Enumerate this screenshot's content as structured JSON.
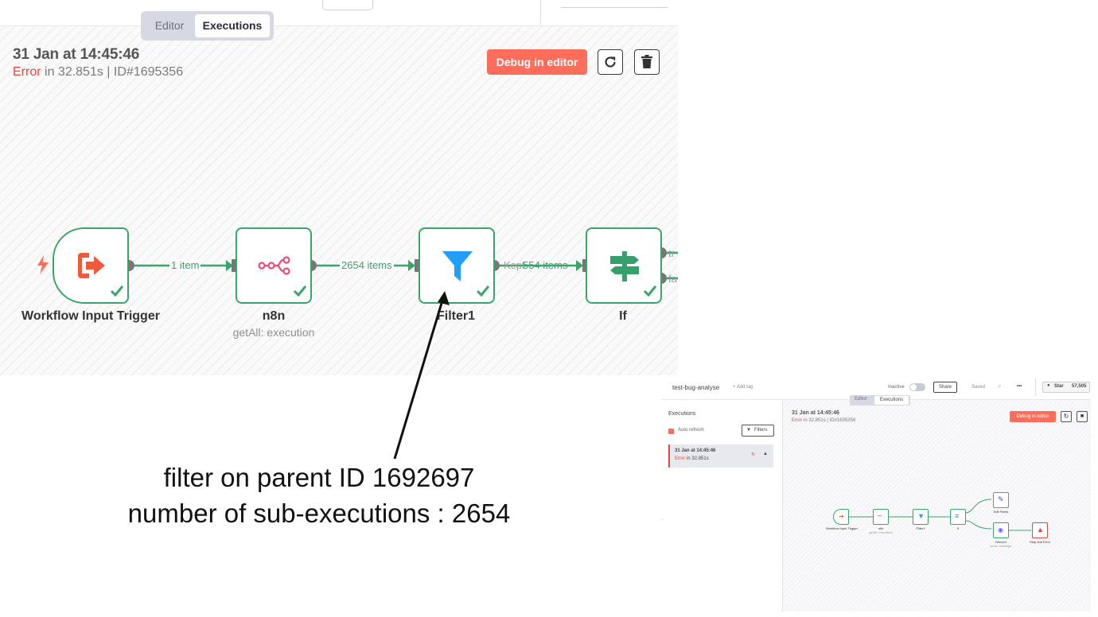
{
  "tabs": {
    "editor": "Editor",
    "executions": "Executions"
  },
  "execution": {
    "time": "31 Jan at 14:45:46",
    "status": "Error",
    "details": "in 32.851s | ID#1695356",
    "debug_label": "Debug in editor"
  },
  "nodes": [
    {
      "name": "Workflow Input Trigger",
      "sub": "",
      "icon": "sign-out-icon",
      "color": "#ef5a3c"
    },
    {
      "name": "n8n",
      "sub": "getAll: execution",
      "icon": "n8n-logo-icon",
      "color": "#ea4b71"
    },
    {
      "name": "Filter1",
      "sub": "",
      "icon": "funnel-icon",
      "color": "#229eff"
    },
    {
      "name": "If",
      "sub": "",
      "icon": "signpost-icon",
      "color": "#35a06c"
    }
  ],
  "connections": [
    "1 item",
    "2654 items",
    "Kept",
    "554 items"
  ],
  "if_outputs": [
    "tr",
    "fa"
  ],
  "annotation": {
    "line1": "filter on parent ID 1692697",
    "line2": "number of sub-executions : 2654"
  },
  "thumbnail": {
    "workflow_name": "test-bug-analyse",
    "add_tag": "+ Add tag",
    "inactive": "Inactive",
    "share": "Share",
    "saved": "Saved",
    "more": "•••",
    "star": "Star",
    "star_count": "57,505",
    "executions_title": "Executions",
    "auto_refresh": "Auto refresh",
    "filters": "Filters",
    "exec_item_time": "31 Jan at 14:45:46",
    "exec_item_status": "Error",
    "exec_item_duration": "in 32.851s",
    "exec_time": "31 Jan at 14:45:46",
    "exec_status": "Error",
    "exec_details": "in 32.851s | ID#1695356",
    "debug_label": "Debug in editor",
    "nodes": [
      "Workflow Input Trigger",
      "n8n",
      "Filter1",
      "If",
      "Edit Fields",
      "Discord",
      "Stop and Error"
    ],
    "node_subs": [
      "getAll: execution",
      "send: message"
    ]
  },
  "colors": {
    "success": "#3aa569",
    "error": "#e3463b",
    "accent": "#ff6d5a"
  }
}
